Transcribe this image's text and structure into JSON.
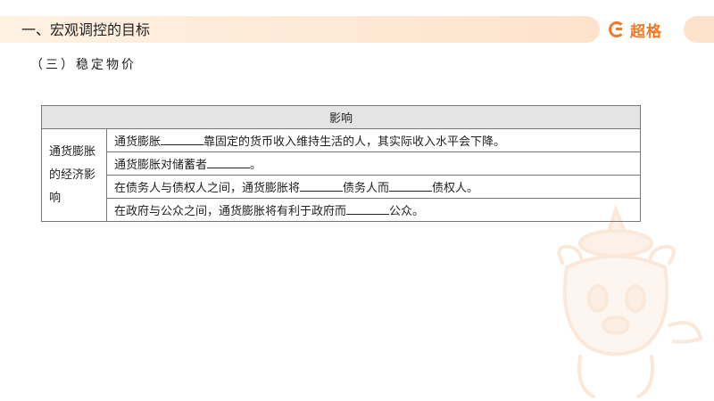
{
  "header": {
    "title": "一、宏观调控的目标",
    "brand": "超格"
  },
  "subtitle": "（三）稳定物价",
  "table": {
    "column_header": "影响",
    "row_header": "通货膨胀的经济影响",
    "rows": [
      {
        "parts": [
          "通货膨胀",
          "",
          "靠固定的货币收入维持生活的人，其实际收入水平会下降。"
        ]
      },
      {
        "parts": [
          "通货膨胀对储蓄者",
          "",
          "。"
        ]
      },
      {
        "parts": [
          "在债务人与债权人之间，通货膨胀将",
          "",
          "债务人而",
          "",
          "债权人。"
        ]
      },
      {
        "parts": [
          "在政府与公众之间，通货膨胀将有利于政府而",
          "",
          "公众。"
        ]
      }
    ]
  },
  "colors": {
    "accent": "#f07a2a",
    "header_band": "#fde3cc",
    "table_header": "#e4e4e4"
  }
}
